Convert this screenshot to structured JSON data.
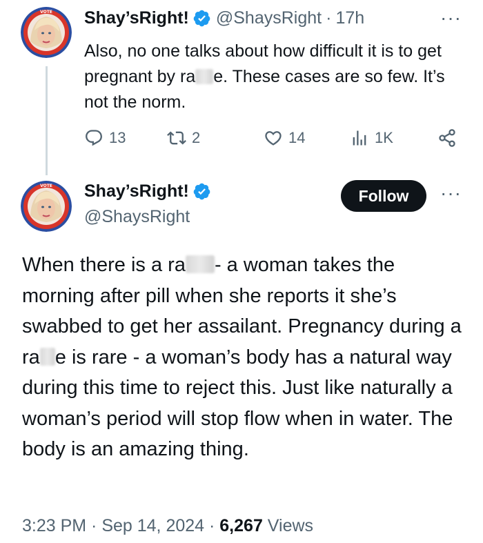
{
  "tweet1": {
    "name": "Shay’sRight!",
    "handle": "@ShaysRight",
    "separator": "·",
    "time": "17h",
    "text_part1": "Also, no one talks about how difficult it is to get pregnant by ra",
    "text_part2": "e. These cases are so few. It’s not the norm.",
    "replies": "13",
    "retweets": "2",
    "likes": "14",
    "views": "1K"
  },
  "tweet2": {
    "name": "Shay’sRight!",
    "handle": "@ShaysRight",
    "follow_label": "Follow",
    "text_part1": "When there is a ra",
    "text_part2": "- a woman takes the morning after pill when she reports it she’s swabbed to get her assailant.  Pregnancy during a ra",
    "text_part3": "e is rare - a woman’s body has a natural way during this time to reject this. Just like naturally a woman’s period will stop flow when in water. The body is an amazing thing.",
    "timestamp": "3:23 PM · Sep 14, 2024 · ",
    "views_count": "6,267",
    "views_label": " Views"
  },
  "more_label": "···",
  "avatar_badge_text": "VOTE",
  "avatar_badge_subtext": "MAKE A PLAN",
  "colors": {
    "verified": "#1d9bf0",
    "muted": "#536471",
    "text": "#0f1419",
    "avatar_ring_red": "#d8352a",
    "avatar_ring_blue": "#2b4ea2"
  },
  "icons": [
    "reply-icon",
    "retweet-icon",
    "like-icon",
    "views-icon",
    "share-icon",
    "verified-badge-icon",
    "more-icon"
  ]
}
